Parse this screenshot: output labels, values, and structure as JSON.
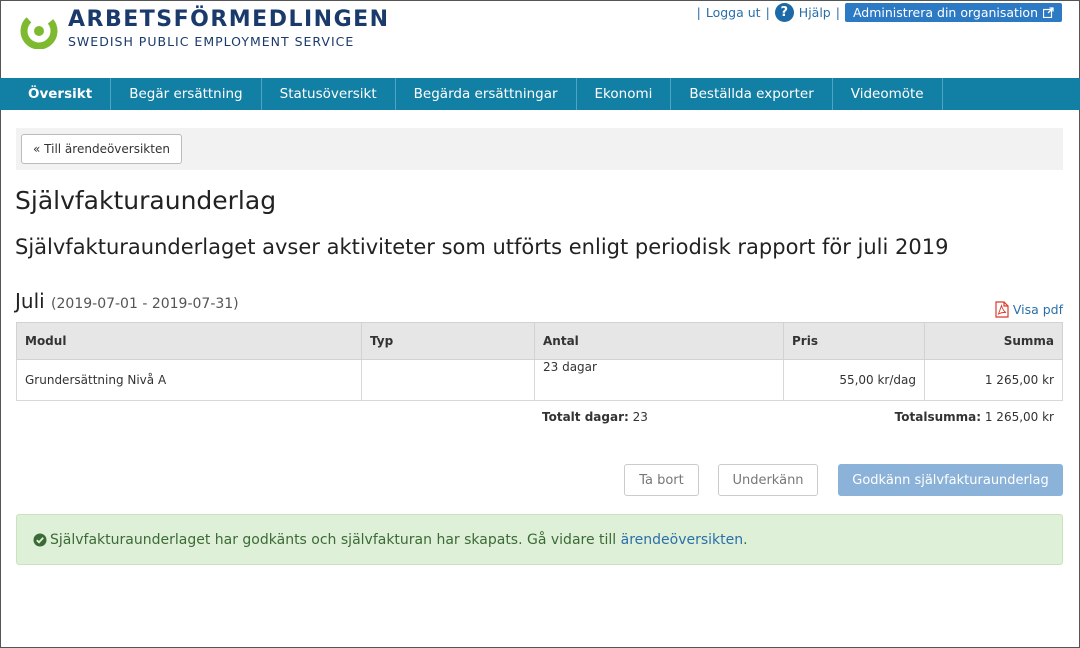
{
  "header": {
    "brand_name": "ARBETSFÖRMEDLINGEN",
    "brand_sub": "SWEDISH PUBLIC EMPLOYMENT SERVICE",
    "sep": "|",
    "logout": "Logga ut",
    "help": "Hjälp",
    "admin": "Administrera din organisation"
  },
  "nav": {
    "items": [
      "Översikt",
      "Begär ersättning",
      "Statusöversikt",
      "Begärda ersättningar",
      "Ekonomi",
      "Beställda exporter",
      "Videomöte"
    ]
  },
  "back_button": "« Till ärendeöversikten",
  "page_title": "Självfakturaunderlag",
  "subtitle": "Självfakturaunderlaget avser aktiviteter som utförts enligt periodisk rapport för juli 2019",
  "period": {
    "month": "Juli",
    "range": "(2019-07-01 - 2019-07-31)"
  },
  "visa_pdf": "Visa pdf",
  "table": {
    "headers": [
      "Modul",
      "Typ",
      "Antal",
      "Pris",
      "Summa"
    ],
    "rows": [
      {
        "modul": "Grundersättning Nivå A",
        "typ": "",
        "antal": "23 dagar",
        "pris": "55,00 kr/dag",
        "summa": "1 265,00 kr"
      }
    ]
  },
  "totals": {
    "days_label": "Totalt dagar:",
    "days_value": "23",
    "sum_label": "Totalsumma:",
    "sum_value": "1 265,00 kr"
  },
  "actions": {
    "remove": "Ta bort",
    "reject": "Underkänn",
    "approve": "Godkänn självfakturaunderlag"
  },
  "success": {
    "text": "Självfakturaunderlaget har godkänts och självfakturan har skapats. Gå vidare till",
    "link": "ärendeöversikten",
    "end": "."
  },
  "colors": {
    "nav": "#127fa4",
    "brand": "#1a3a6b",
    "logo_green": "#7dba2f",
    "primary_disabled": "#8bb2d8",
    "success_bg": "#dff0d8"
  },
  "icons": [
    "logo-icon",
    "help-icon",
    "external-link-icon",
    "pdf-icon",
    "check-circle-icon"
  ]
}
